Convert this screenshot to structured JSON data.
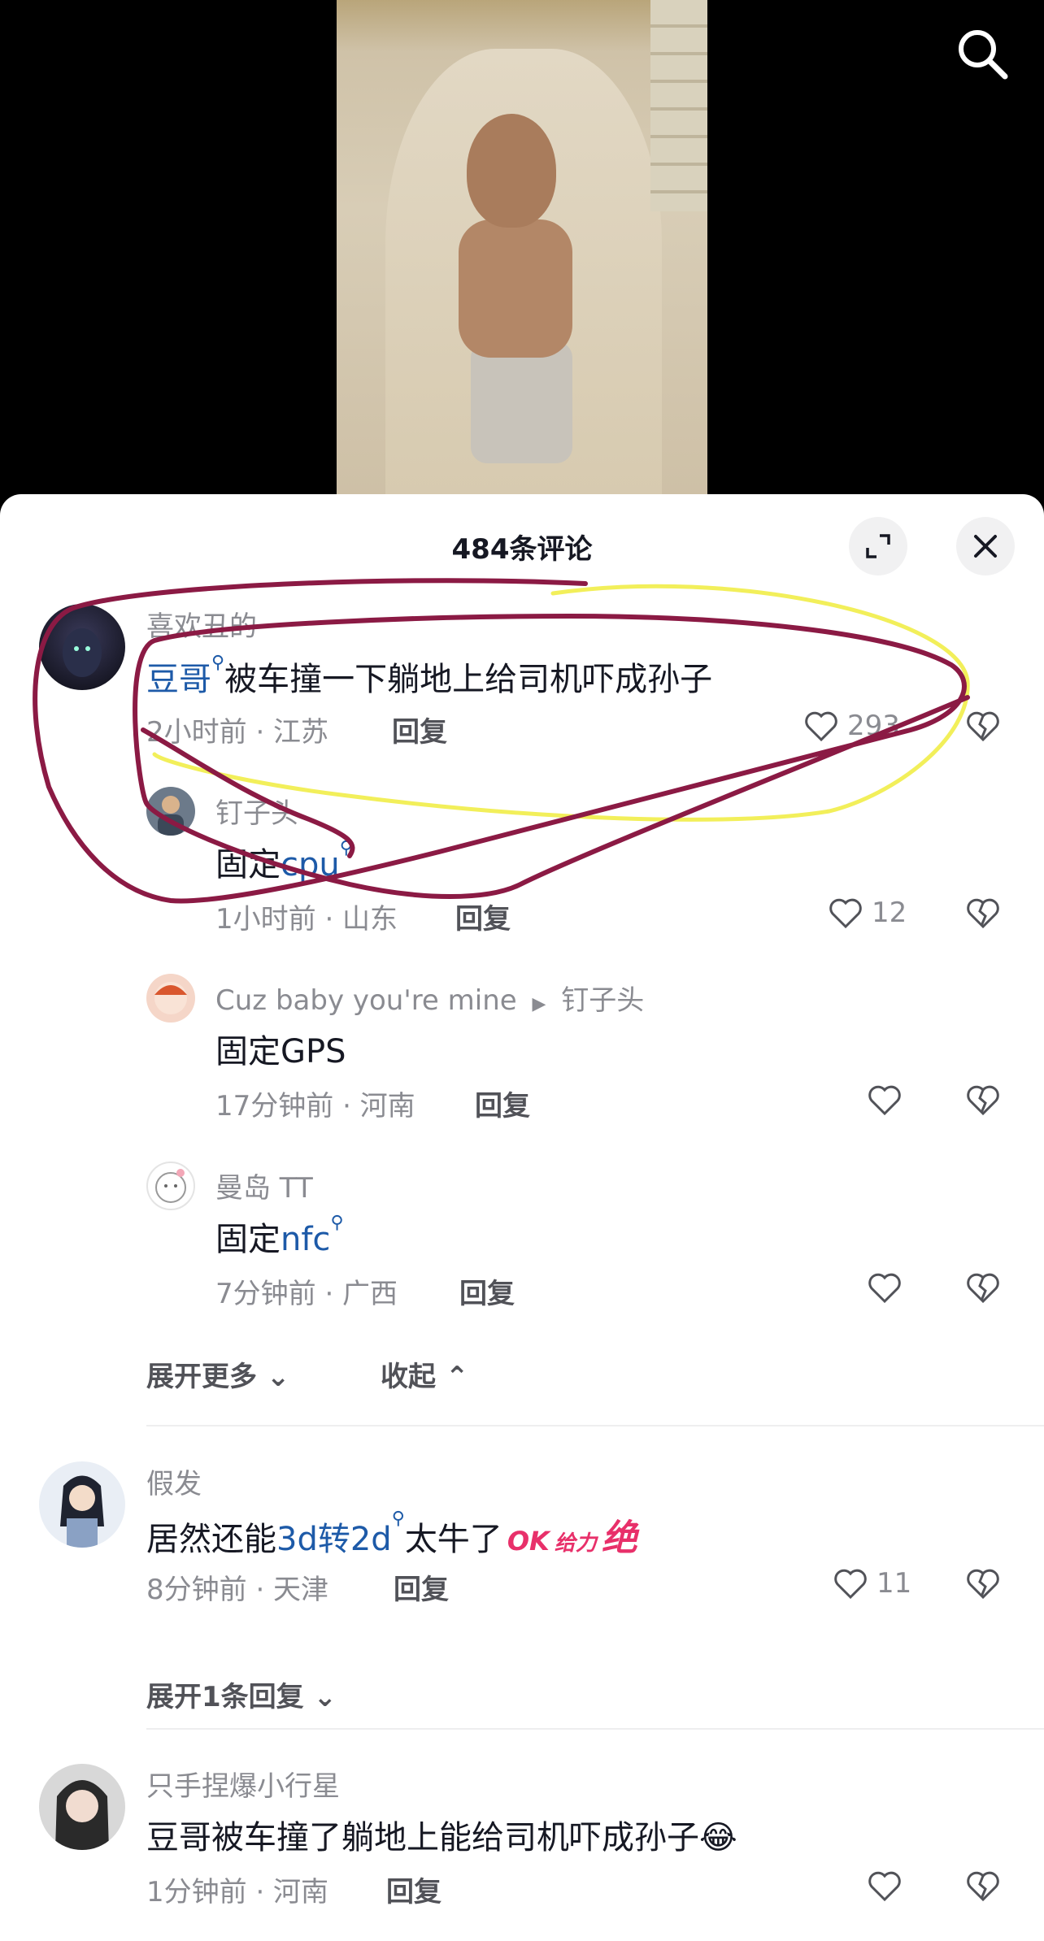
{
  "video": {
    "search_icon": "search-icon"
  },
  "sheet": {
    "count_label": "484条评论"
  },
  "comments": [
    {
      "user": "喜欢丑的",
      "link": "豆哥",
      "text": "被车撞一下躺地上给司机吓成孙子",
      "time": "2小时前 · 江苏",
      "reply": "回复",
      "likes": "293"
    },
    {
      "user": "钉子头",
      "prefix": "固定",
      "link": "cpu",
      "time": "1小时前 · 山东",
      "reply": "回复",
      "likes": "12"
    },
    {
      "user": "Cuz baby you're mine",
      "reply_to": "钉子头",
      "text": "固定GPS",
      "time": "17分钟前 · 河南",
      "reply": "回复"
    },
    {
      "user": "曼岛 TT",
      "prefix": "固定",
      "link": "nfc",
      "time": "7分钟前 · 广西",
      "reply": "回复"
    },
    {
      "user": "假发",
      "prefix": "居然还能",
      "link": "3d转2d",
      "suffix": "太牛了",
      "sticker1": "OK",
      "sticker2": "给力",
      "sticker3": "绝",
      "time": "8分钟前 · 天津",
      "reply": "回复",
      "likes": "11"
    },
    {
      "user": "只手捏爆小行星",
      "text": "豆哥被车撞了躺地上能给司机吓成孙子",
      "emoji": "😂",
      "time": "1分钟前 · 河南",
      "reply": "回复"
    }
  ],
  "actions": {
    "expand_more": "展开更多",
    "collapse": "收起",
    "expand_one": "展开1条回复"
  },
  "colors": {
    "link": "#1d5aa8",
    "annotation_red": "#8b1a44",
    "annotation_yellow": "#f2ef5a"
  }
}
